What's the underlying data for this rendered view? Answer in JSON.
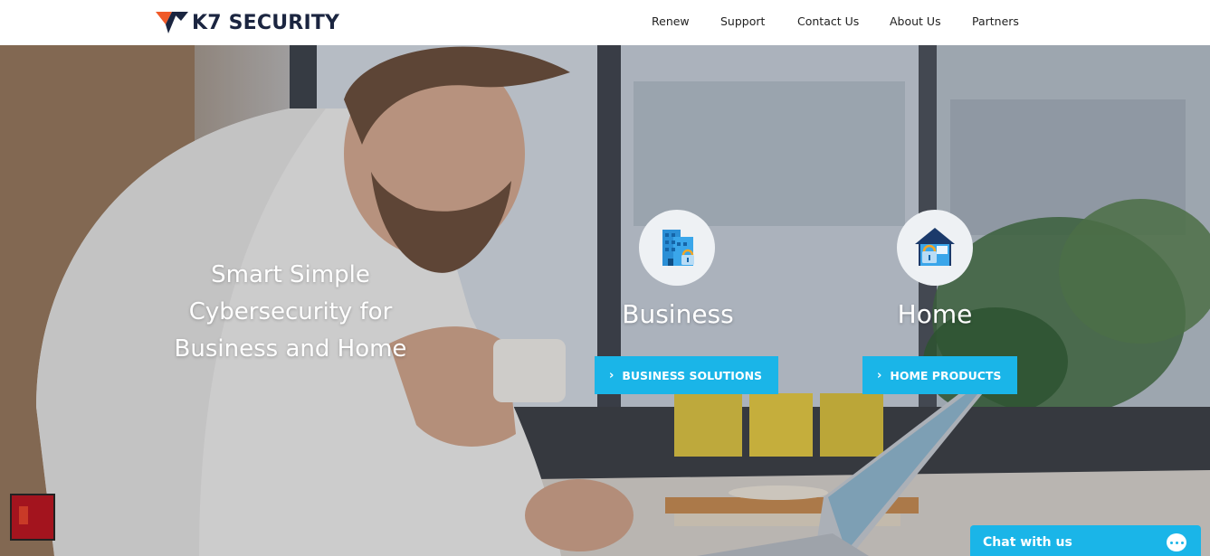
{
  "header": {
    "brand": "K7 SECURITY",
    "nav": [
      "Renew",
      "Support",
      "Contact Us",
      "About Us",
      "Partners"
    ]
  },
  "hero": {
    "tagline": [
      "Smart Simple",
      "Cybersecurity for",
      "Business and Home"
    ],
    "business": {
      "title": "Business",
      "cta": "BUSINESS SOLUTIONS",
      "icon": "office-building-lock-icon"
    },
    "home": {
      "title": "Home",
      "cta": "HOME PRODUCTS",
      "icon": "house-lock-icon"
    }
  },
  "chat": {
    "label": "Chat with us",
    "icon": "chat-bubble-icon"
  },
  "colors": {
    "accent": "#1ab5e8",
    "brand_dark": "#1b2540",
    "brand_orange": "#f05a28"
  }
}
